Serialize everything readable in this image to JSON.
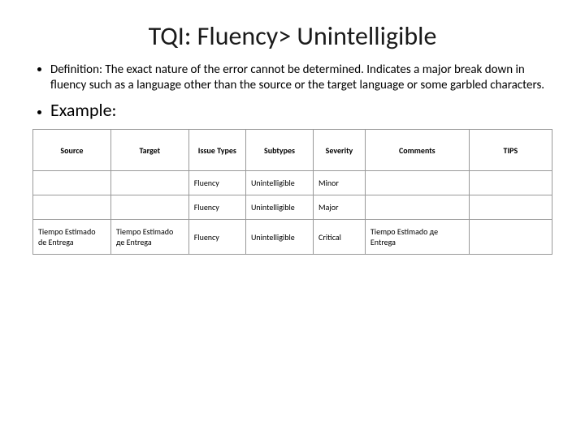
{
  "title": "TQI: Fluency> Unintelligible",
  "definition_label": "Definition: ",
  "definition_text": "The exact nature of the error cannot be determined. Indicates a major break down in fluency such as a language other than the source or the target language or some garbled characters.",
  "example_label": "Example:",
  "table": {
    "headers": [
      "Source",
      "Target",
      "Issue Types",
      "Subtypes",
      "Severity",
      "Comments",
      "TIPS"
    ],
    "rows": [
      {
        "source": "",
        "target": "",
        "issue": "Fluency",
        "subtype": "Unintelligible",
        "severity": "Minor",
        "comments": "",
        "tips": ""
      },
      {
        "source": "",
        "target": "",
        "issue": "Fluency",
        "subtype": "Unintelligible",
        "severity": "Major",
        "comments": "",
        "tips": ""
      },
      {
        "source": "Tiempo Estimado de Entrega",
        "target": "Tiempo Estimado де Entrega",
        "issue": "Fluency",
        "subtype": "Unintelligible",
        "severity": "Critical",
        "comments": "Tiempo Estimado де Entrega",
        "tips": ""
      }
    ]
  }
}
